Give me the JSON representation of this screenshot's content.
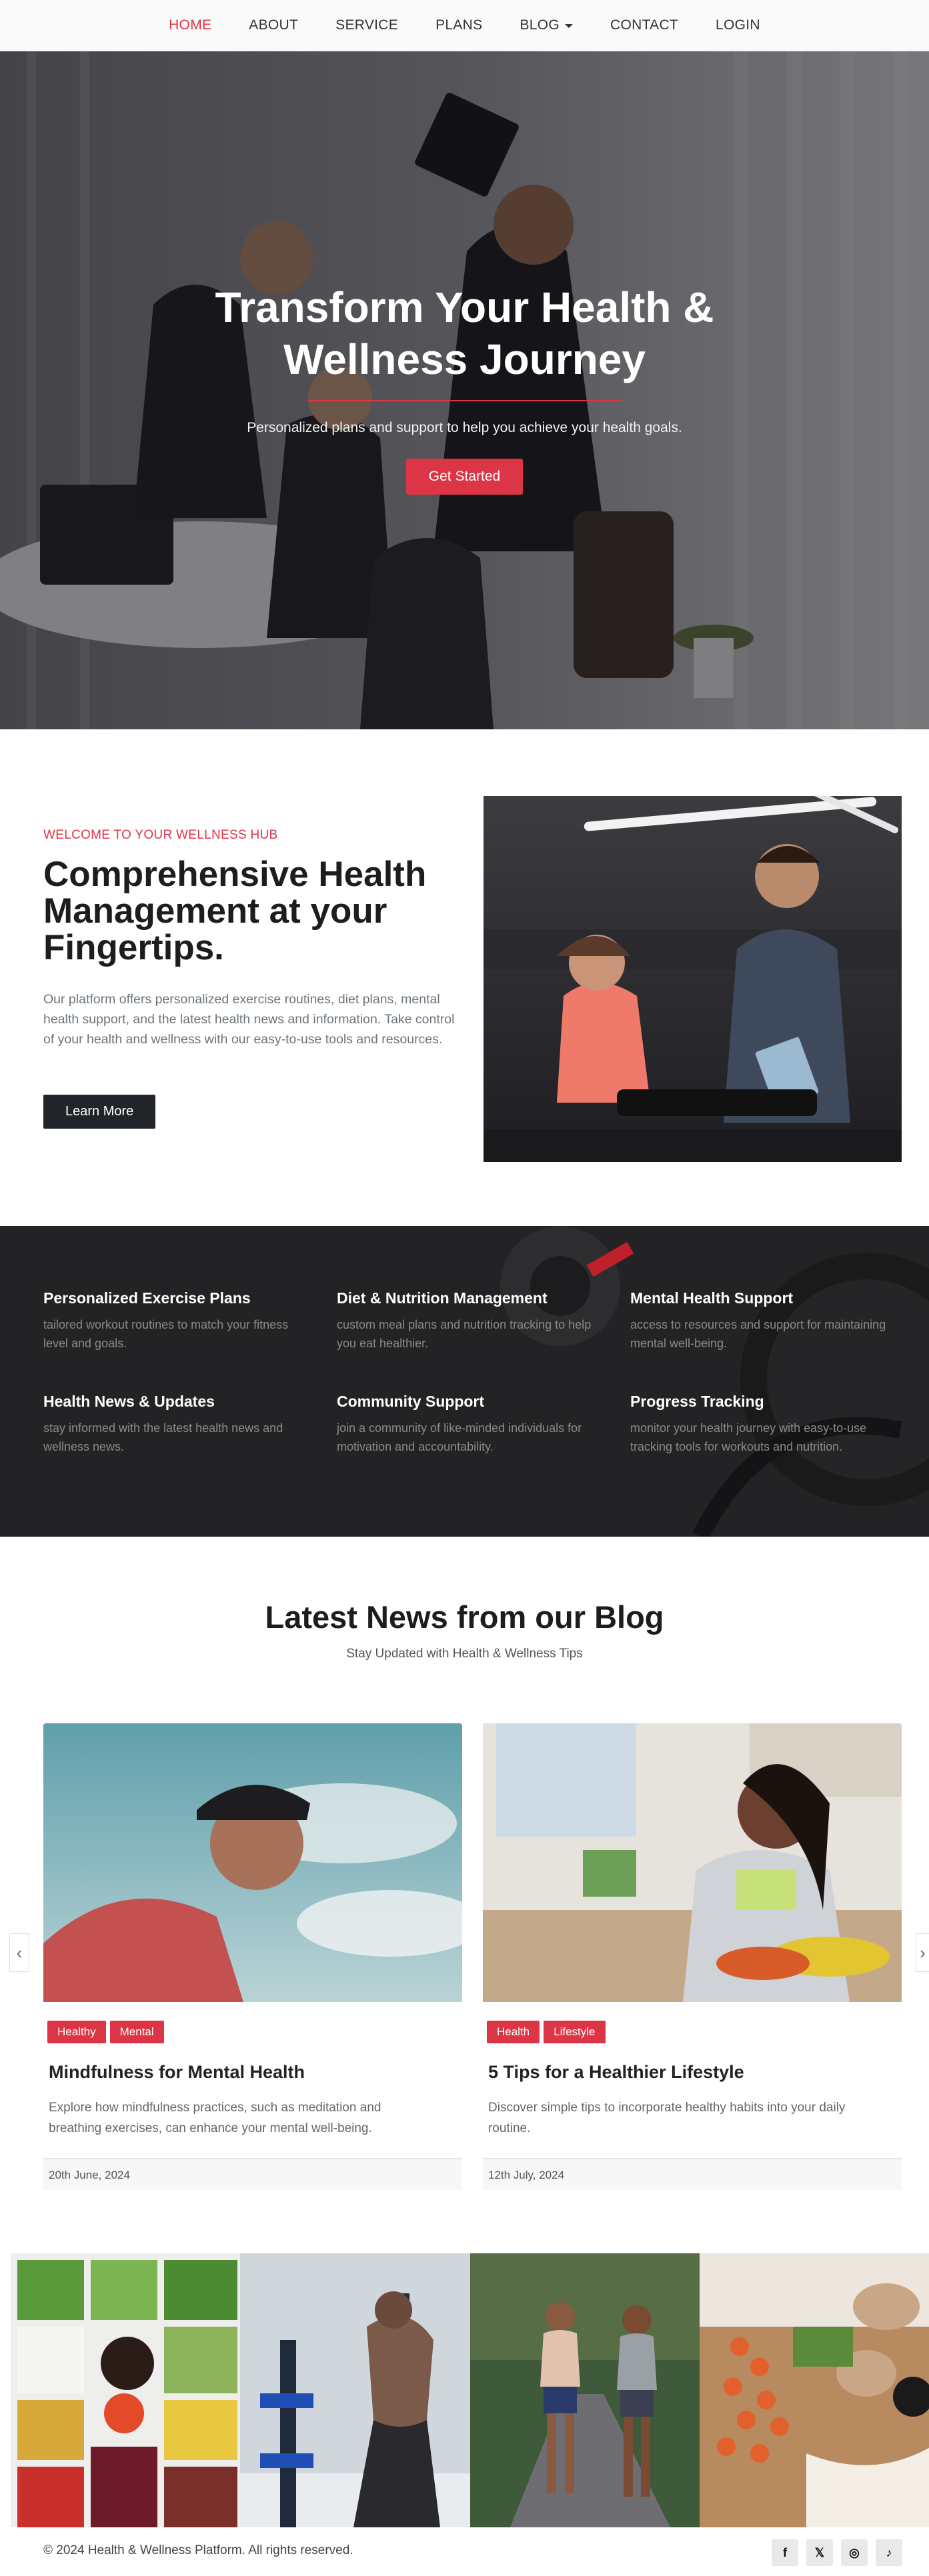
{
  "nav": {
    "items": [
      {
        "label": "HOME",
        "active": true
      },
      {
        "label": "ABOUT"
      },
      {
        "label": "SERVICE"
      },
      {
        "label": "PLANS"
      },
      {
        "label": "BLOG",
        "dropdown": true
      },
      {
        "label": "CONTACT"
      },
      {
        "label": "LOGIN"
      }
    ]
  },
  "hero": {
    "title": "Transform Your Health & Wellness Journey",
    "subtitle": "Personalized plans and support to help you achieve your health goals.",
    "cta": "Get Started"
  },
  "about": {
    "eyebrow": "WELCOME TO YOUR WELLNESS HUB",
    "title": "Comprehensive Health Management at your Fingertips.",
    "text": "Our platform offers personalized exercise routines, diet plans, mental health support, and the latest health news and information. Take control of your health and wellness with our easy-to-use tools and resources.",
    "cta": "Learn More"
  },
  "features": [
    {
      "title": "Personalized Exercise Plans",
      "text": "tailored workout routines to match your fitness level and goals."
    },
    {
      "title": "Diet & Nutrition Management",
      "text": "custom meal plans and nutrition tracking to help you eat healthier."
    },
    {
      "title": "Mental Health Support",
      "text": "access to resources and support for maintaining mental well-being."
    },
    {
      "title": "Health News & Updates",
      "text": "stay informed with the latest health news and wellness news."
    },
    {
      "title": "Community Support",
      "text": "join a community of like-minded individuals for motivation and accountability."
    },
    {
      "title": "Progress Tracking",
      "text": "monitor your health journey with easy-to-use tracking tools for workouts and nutrition."
    }
  ],
  "blog": {
    "title": "Latest News from our Blog",
    "subtitle": "Stay Updated with Health & Wellness Tips",
    "posts": [
      {
        "tags": [
          "Healthy",
          "Mental"
        ],
        "title": "Mindfulness for Mental Health",
        "text": "Explore how mindfulness practices, such as meditation and breathing exercises, can enhance your mental well-being.",
        "date": "20th June, 2024"
      },
      {
        "tags": [
          "Health",
          "Lifestyle"
        ],
        "title": "5 Tips for a Healthier Lifestyle",
        "text": "Discover simple tips to incorporate healthy habits into your daily routine.",
        "date": "12th July, 2024"
      }
    ],
    "prev": "‹",
    "next": "›"
  },
  "footer": {
    "copyright": "© 2024 Health & Wellness Platform. All rights reserved.",
    "social": [
      {
        "icon": "facebook-icon",
        "glyph": "f"
      },
      {
        "icon": "twitter-icon",
        "glyph": "𝕏"
      },
      {
        "icon": "instagram-icon",
        "glyph": "◎"
      },
      {
        "icon": "tiktok-icon",
        "glyph": "♪"
      }
    ]
  },
  "colors": {
    "accent": "#dc3545",
    "dark": "#212529"
  }
}
